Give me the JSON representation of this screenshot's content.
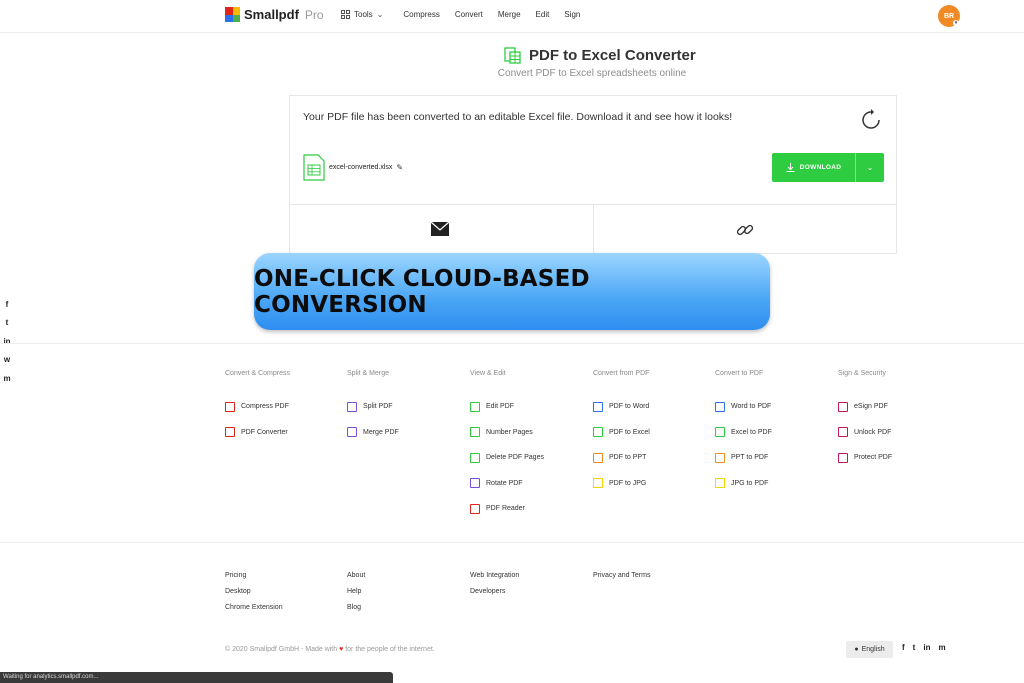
{
  "header": {
    "brand": "Smallpdf",
    "brand_suffix": "Pro",
    "tools_label": "Tools",
    "nav": [
      "Compress",
      "Convert",
      "Merge",
      "Edit",
      "Sign"
    ],
    "avatar_initials": "BR"
  },
  "page": {
    "title": "PDF to Excel Converter",
    "subtitle": "Convert PDF to Excel spreadsheets online"
  },
  "result": {
    "message": "Your PDF file has been converted to an editable Excel file. Download it and see how it looks!",
    "file_name": "excel-converted.xlsx",
    "download_label": "DOWNLOAD"
  },
  "banner": {
    "text": "ONE-CLICK CLOUD-BASED CONVERSION"
  },
  "tools": [
    {
      "heading": "Convert & Compress",
      "items": [
        {
          "label": "Compress PDF",
          "color": "#e2231a"
        },
        {
          "label": "PDF Converter",
          "color": "#e2231a"
        }
      ]
    },
    {
      "heading": "Split & Merge",
      "items": [
        {
          "label": "Split PDF",
          "color": "#7b4fd6"
        },
        {
          "label": "Merge PDF",
          "color": "#7b4fd6"
        }
      ]
    },
    {
      "heading": "View & Edit",
      "items": [
        {
          "label": "Edit PDF",
          "color": "#2ecc40"
        },
        {
          "label": "Number Pages",
          "color": "#2ecc40"
        },
        {
          "label": "Delete PDF Pages",
          "color": "#2ecc40"
        },
        {
          "label": "Rotate PDF",
          "color": "#7b4fd6"
        },
        {
          "label": "PDF Reader",
          "color": "#e2231a"
        }
      ]
    },
    {
      "heading": "Convert from PDF",
      "items": [
        {
          "label": "PDF to Word",
          "color": "#2f70e8"
        },
        {
          "label": "PDF to Excel",
          "color": "#2ecc40"
        },
        {
          "label": "PDF to PPT",
          "color": "#f08a24"
        },
        {
          "label": "PDF to JPG",
          "color": "#f9d000"
        }
      ]
    },
    {
      "heading": "Convert to PDF",
      "items": [
        {
          "label": "Word to PDF",
          "color": "#2f70e8"
        },
        {
          "label": "Excel to PDF",
          "color": "#2ecc40"
        },
        {
          "label": "PPT to PDF",
          "color": "#f08a24"
        },
        {
          "label": "JPG to PDF",
          "color": "#f9d000"
        }
      ]
    },
    {
      "heading": "Sign & Security",
      "items": [
        {
          "label": "eSign PDF",
          "color": "#c2185b"
        },
        {
          "label": "Unlock PDF",
          "color": "#c2185b"
        },
        {
          "label": "Protect PDF",
          "color": "#c2185b"
        }
      ]
    }
  ],
  "footer": {
    "col1": [
      "Pricing",
      "Desktop",
      "Chrome Extension"
    ],
    "col2": [
      "About",
      "Help",
      "Blog"
    ],
    "col3": [
      "Web Integration",
      "Developers"
    ],
    "col4": [
      "Privacy and Terms"
    ],
    "copyright_prefix": "© 2020 Smallpdf GmbH  -  Made with",
    "copyright_suffix": "for the people of the internet.",
    "language": "English"
  },
  "social": [
    "f",
    "t",
    "in",
    "w",
    "m"
  ],
  "status_bar": "Waiting for analytics.smallpdf.com...",
  "colors": {
    "accent_green": "#2ecc40",
    "avatar": "#f08a24",
    "banner_blue": "#4aa6f5"
  }
}
